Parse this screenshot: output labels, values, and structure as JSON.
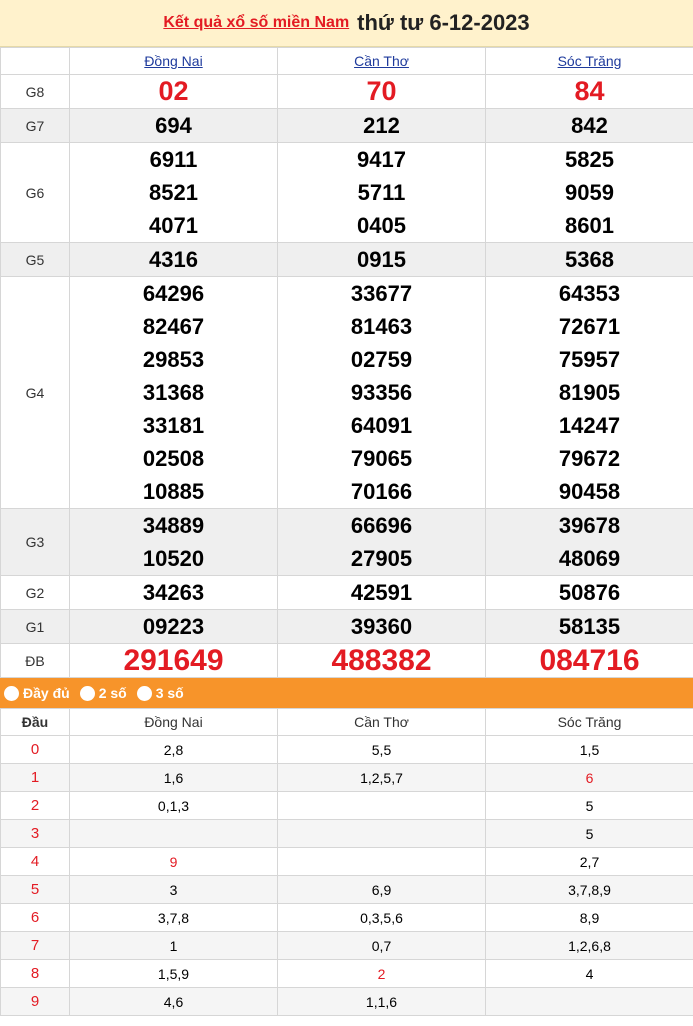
{
  "header": {
    "link_text": "Kết quả xổ số miền Nam",
    "date_text": "thứ tư 6-12-2023"
  },
  "provinces": [
    "Đồng Nai",
    "Cần Thơ",
    "Sóc Trăng"
  ],
  "prizes": [
    {
      "label": "G8",
      "values": [
        [
          "02"
        ],
        [
          "70"
        ],
        [
          "84"
        ]
      ]
    },
    {
      "label": "G7",
      "values": [
        [
          "694"
        ],
        [
          "212"
        ],
        [
          "842"
        ]
      ]
    },
    {
      "label": "G6",
      "values": [
        [
          "6911",
          "8521",
          "4071"
        ],
        [
          "9417",
          "5711",
          "0405"
        ],
        [
          "5825",
          "9059",
          "8601"
        ]
      ]
    },
    {
      "label": "G5",
      "values": [
        [
          "4316"
        ],
        [
          "0915"
        ],
        [
          "5368"
        ]
      ]
    },
    {
      "label": "G4",
      "values": [
        [
          "64296",
          "82467",
          "29853",
          "31368",
          "33181",
          "02508",
          "10885"
        ],
        [
          "33677",
          "81463",
          "02759",
          "93356",
          "64091",
          "79065",
          "70166"
        ],
        [
          "64353",
          "72671",
          "75957",
          "81905",
          "14247",
          "79672",
          "90458"
        ]
      ]
    },
    {
      "label": "G3",
      "values": [
        [
          "34889",
          "10520"
        ],
        [
          "66696",
          "27905"
        ],
        [
          "39678",
          "48069"
        ]
      ]
    },
    {
      "label": "G2",
      "values": [
        [
          "34263"
        ],
        [
          "42591"
        ],
        [
          "50876"
        ]
      ]
    },
    {
      "label": "G1",
      "values": [
        [
          "09223"
        ],
        [
          "39360"
        ],
        [
          "58135"
        ]
      ]
    },
    {
      "label": "ĐB",
      "values": [
        [
          "291649"
        ],
        [
          "488382"
        ],
        [
          "084716"
        ]
      ]
    }
  ],
  "options": [
    "Đầy đủ",
    "2 số",
    "3 số"
  ],
  "stats": {
    "head_label": "Đầu",
    "rows": [
      {
        "d": "0",
        "v": [
          "2,8",
          "5,5",
          "1,5"
        ]
      },
      {
        "d": "1",
        "v": [
          "1,6",
          "1,2,5,7",
          "6"
        ]
      },
      {
        "d": "2",
        "v": [
          "0,1,3",
          "",
          "5"
        ]
      },
      {
        "d": "3",
        "v": [
          "",
          "",
          "5"
        ]
      },
      {
        "d": "4",
        "v": [
          "9",
          "",
          "2,7"
        ]
      },
      {
        "d": "5",
        "v": [
          "3",
          "6,9",
          "3,7,8,9"
        ]
      },
      {
        "d": "6",
        "v": [
          "3,7,8",
          "0,3,5,6",
          "8,9"
        ]
      },
      {
        "d": "7",
        "v": [
          "1",
          "0,7",
          "1,2,6,8"
        ]
      },
      {
        "d": "8",
        "v": [
          "1,5,9",
          "2",
          "4"
        ]
      },
      {
        "d": "9",
        "v": [
          "4,6",
          "1,1,6",
          ""
        ]
      }
    ],
    "highlight_red": [
      "1-2",
      "4-0",
      "8-1"
    ]
  },
  "colors": {
    "accent_red": "#e31b23",
    "option_bar": "#f7942a",
    "header_bg": "#fff2cc",
    "province_link": "#1e3a9c"
  }
}
